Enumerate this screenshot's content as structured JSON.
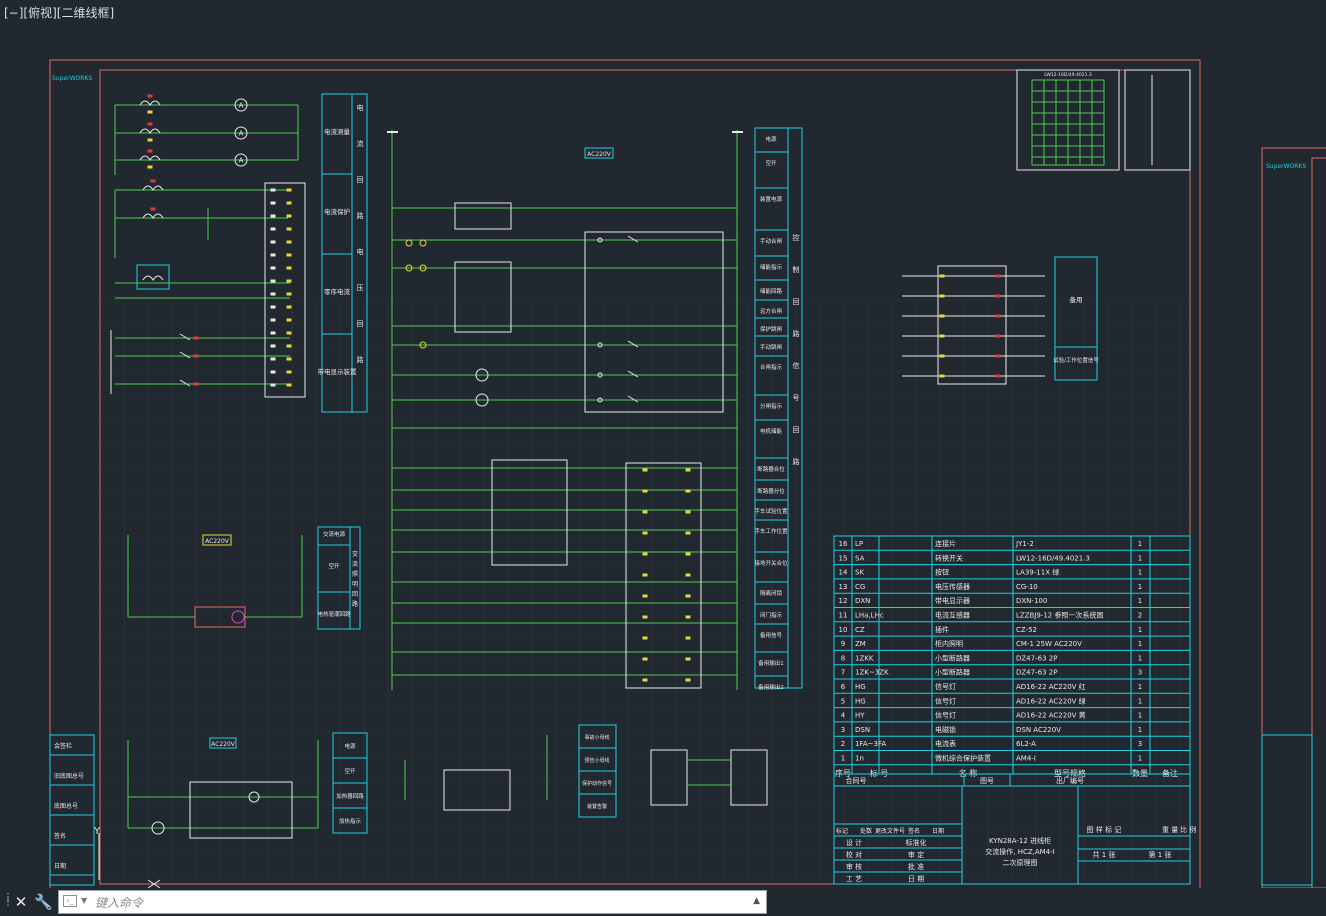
{
  "view_label": "[−][俯视][二维线框]",
  "command": {
    "placeholder": "键入命令"
  },
  "colors": {
    "background": "#212830",
    "frame": "#e06a6a",
    "wire": "#4ecb4e",
    "cyan": "#1fd0e0",
    "white": "#e9e9e9",
    "red": "#e23a3a",
    "yellow": "#e8d93a"
  },
  "drawing": {
    "left_strip": {
      "brand": "SuperWORKS",
      "labels": [
        "会签栏",
        "旧底图总号",
        "底图总号",
        "签名",
        "日期"
      ]
    },
    "right_strip": {
      "brand": "SuperWORKS"
    },
    "vertical_panel_1": {
      "rows": [
        {
          "text": "电流测量",
          "side": "电"
        },
        {
          "text": "电流保护",
          "side": "流"
        },
        {
          "text": "零序电流",
          "side": "回"
        },
        {
          "text": "带电显示装置",
          "side": "路"
        }
      ],
      "right_labels": [
        "电",
        "流",
        "回",
        "路",
        "电",
        "压",
        "回",
        "路"
      ]
    },
    "vertical_panel_2": {
      "rows": [
        "电源",
        "空开",
        "装置电源",
        "手动合闸",
        "储能指示",
        "储能回路",
        "远方合闸",
        "保护跳闸",
        "手动跳闸",
        "合闸指示",
        "分闸指示",
        "电机储能",
        "断路器合位",
        "断路器分位",
        "手车试验位置",
        "手车工作位置",
        "接地开关合位",
        "隔离闭锁",
        "闭门指示",
        "备用信号",
        "备用输出1",
        "备用输出2"
      ],
      "right_labels": [
        "控",
        "制",
        "回",
        "路",
        "信",
        "号",
        "回",
        "路"
      ]
    },
    "lighting_panel": {
      "rows": [
        "交流电源",
        "空开",
        "电热驱潮回路"
      ],
      "right_labels": [
        "交",
        "流",
        "照",
        "明",
        "回",
        "路"
      ]
    },
    "heater_panel": {
      "rows": [
        "电源",
        "空开",
        "加热器回路",
        "加热指示"
      ]
    },
    "signal_panel": {
      "rows": [
        "事故小母线",
        "预告小母线",
        "保护动作信号",
        "装置告警"
      ]
    },
    "ac220v_labels": [
      "AC220V",
      "AC220V",
      "AC220V"
    ],
    "parts_table": {
      "headers": [
        "序号",
        "标 号",
        "名  称",
        "型号规格",
        "数量",
        "备注"
      ],
      "rows": [
        [
          "16",
          "LP",
          "连接片",
          "JY1-2",
          "1",
          ""
        ],
        [
          "15",
          "SA",
          "转换开关",
          "LW12-16D/49.4021.3",
          "1",
          ""
        ],
        [
          "14",
          "SK",
          "按钮",
          "LA39-11X 绿",
          "1",
          ""
        ],
        [
          "13",
          "CG",
          "电压传感器",
          "CG-10",
          "1",
          ""
        ],
        [
          "12",
          "DXN",
          "带电显示器",
          "DXN-100",
          "1",
          ""
        ],
        [
          "11",
          "LHa,LHc",
          "电流互感器",
          "LZZBJ9-12 参照一次系统图",
          "2",
          ""
        ],
        [
          "10",
          "CZ",
          "插件",
          "CZ-52",
          "1",
          ""
        ],
        [
          "9",
          "ZM",
          "柜内照明",
          "CM-1 25W AC220V",
          "1",
          ""
        ],
        [
          "8",
          "1ZKK",
          "小型断路器",
          "DZ47-63 2P",
          "1",
          ""
        ],
        [
          "7",
          "1ZK~3ZK",
          "小型断路器",
          "DZ47-63 2P",
          "3",
          ""
        ],
        [
          "6",
          "HG",
          "信号灯",
          "AD16-22 AC220V 红",
          "1",
          ""
        ],
        [
          "5",
          "HG",
          "信号灯",
          "AD16-22 AC220V 绿",
          "1",
          ""
        ],
        [
          "4",
          "HY",
          "信号灯",
          "AD16-22 AC220V 黄",
          "1",
          ""
        ],
        [
          "3",
          "DSN",
          "电磁锁",
          "DSN AC220V",
          "1",
          ""
        ],
        [
          "2",
          "1FA~3FA",
          "电流表",
          "6L2-A",
          "3",
          ""
        ],
        [
          "1",
          "1n",
          "微机综合保护装置",
          "AM4-I",
          "1",
          ""
        ]
      ]
    },
    "title_block": {
      "contract": "合同号",
      "drawing_no": "图号",
      "factory_no": "出厂编号",
      "row_labels": [
        "标记",
        "处数",
        "更改文件号",
        "签名",
        "日期"
      ],
      "sign_labels": [
        "设 计",
        "校 对",
        "审 核",
        "工 艺"
      ],
      "sign_labels2": [
        "标准化",
        "审 定",
        "批 准",
        "日 期"
      ],
      "title_lines": [
        "KYN28A-12 进线柜",
        "交流操作, HCZ,AM4-I",
        "二次原理图"
      ],
      "stage": "图 样 标 记",
      "weight": "重 量",
      "scale": "比 例",
      "sheets": "共 1 张",
      "sheet": "第 1 张"
    },
    "top_right_block": {
      "title": "LW12-16D/49.4021.3"
    },
    "right_side_labels": [
      "备用",
      "试验/工作位置信号"
    ]
  }
}
